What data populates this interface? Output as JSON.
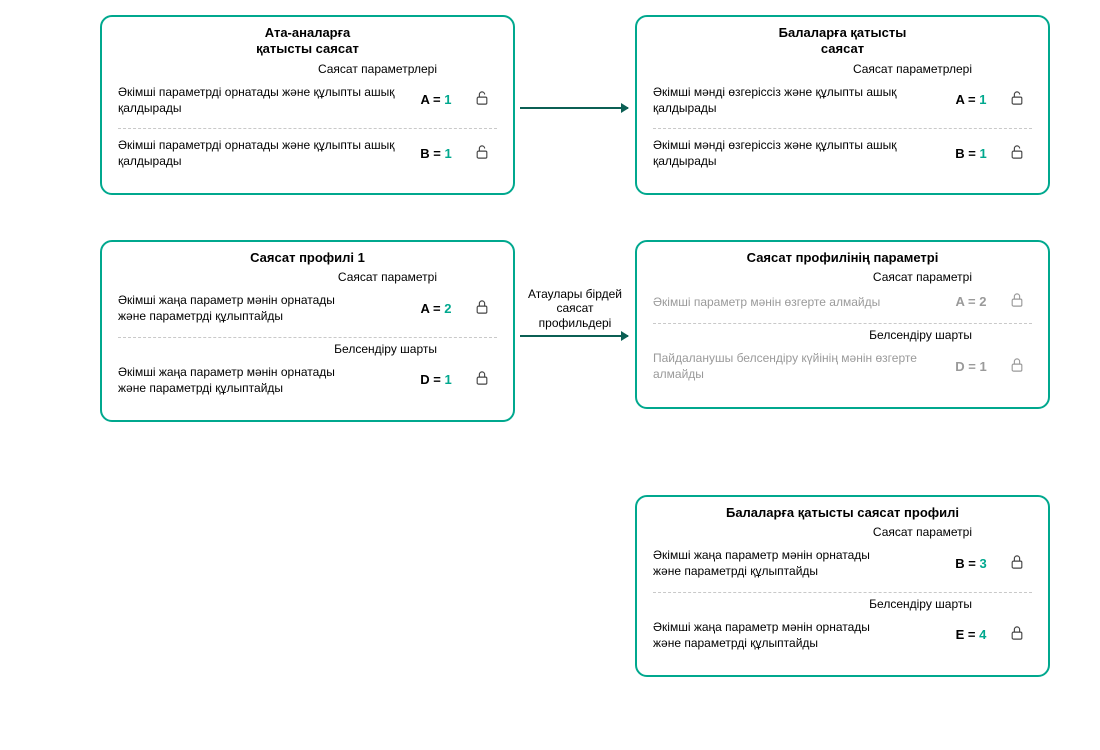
{
  "midLabel": "Атаулары бірдей саясат профильдері",
  "boxes": {
    "parentPolicy": {
      "title": "Ата-аналарға\nқатысты саясат",
      "sectionLabel": "Саясат параметрлері",
      "row1": {
        "desc": "Әкімші параметрді орнатады және құлыпты ашық қалдырады",
        "key": "A",
        "val": "1",
        "lock": "open"
      },
      "row2": {
        "desc": "Әкімші параметрді орнатады және құлыпты ашық қалдырады",
        "key": "B",
        "val": "1",
        "lock": "open"
      }
    },
    "childPolicy": {
      "title": "Балаларға қатысты\nсаясат",
      "sectionLabel": "Саясат параметрлері",
      "row1": {
        "desc": "Әкімші мәнді өзгеріссіз және құлыпты ашық қалдырады",
        "key": "A",
        "val": "1",
        "lock": "open"
      },
      "row2": {
        "desc": "Әкімші мәнді өзгеріссіз және құлыпты ашық қалдырады",
        "key": "B",
        "val": "1",
        "lock": "open"
      }
    },
    "profile1Left": {
      "title": "Саясат профилі 1",
      "sectionLabel1": "Саясат параметрі",
      "row1": {
        "desc": "Әкімші жаңа параметр мәнін орнатады\n және параметрді құлыптайды",
        "key": "A",
        "val": "2",
        "lock": "closed"
      },
      "sectionLabel2": "Белсендіру шарты",
      "row2": {
        "desc": "Әкімші жаңа параметр мәнін орнатады\n және параметрді құлыптайды",
        "key": "D",
        "val": "1",
        "lock": "closed"
      }
    },
    "profile1Right": {
      "title": "Саясат профилінің параметрі",
      "sectionLabel1": "Саясат параметрі",
      "row1": {
        "desc": "Әкімші параметр мәнін өзгерте алмайды",
        "key": "A",
        "val": "2",
        "lock": "closed",
        "dim": true
      },
      "sectionLabel2": "Белсендіру шарты",
      "row2": {
        "desc": "Пайдаланушы белсендіру күйінің мәнін өзгерте алмайды",
        "key": "D",
        "val": "1",
        "lock": "closed",
        "dim": true
      }
    },
    "childProfile": {
      "title": "Балаларға қатысты саясат профилі",
      "sectionLabel1": "Саясат параметрі",
      "row1": {
        "desc": "Әкімші жаңа параметр мәнін орнатады\n және параметрді құлыптайды",
        "key": "B",
        "val": "3",
        "lock": "closed"
      },
      "sectionLabel2": "Белсендіру шарты",
      "row2": {
        "desc": "Әкімші жаңа параметр мәнін орнатады\n және параметрді құлыптайды",
        "key": "E",
        "val": "4",
        "lock": "closed"
      }
    }
  }
}
